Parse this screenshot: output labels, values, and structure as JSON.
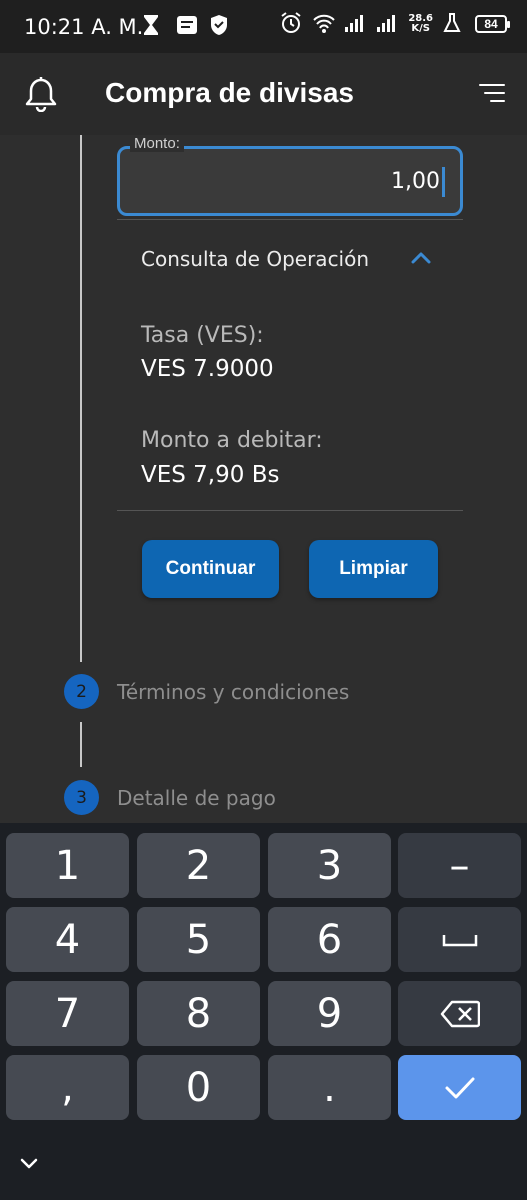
{
  "status_bar": {
    "time": "10:21 A. M.",
    "net_speed_value": "28.6",
    "net_speed_unit": "K/S",
    "battery": "84"
  },
  "app_bar": {
    "title": "Compra de divisas",
    "left_icon": "bell-icon",
    "right_icon": "menu-icon"
  },
  "amount_field": {
    "label": "Monto:",
    "value": "1,00"
  },
  "operation_panel": {
    "title": "Consulta de Operación",
    "rate_label": "Tasa (VES):",
    "rate_value": "VES 7.9000",
    "debit_label": "Monto a debitar:",
    "debit_value": "VES 7,90 Bs"
  },
  "buttons": {
    "continue_label": "Continuar",
    "clear_label": "Limpiar"
  },
  "steps": [
    {
      "number": "2",
      "label": "Términos y condiciones"
    },
    {
      "number": "3",
      "label": "Detalle de pago"
    }
  ],
  "keyboard": {
    "keys": [
      "1",
      "2",
      "3",
      "–",
      "4",
      "5",
      "6",
      "space",
      "7",
      "8",
      "9",
      "backspace",
      ",",
      "0",
      ".",
      "enter"
    ]
  },
  "colors": {
    "accent": "#0e66b2",
    "field_border": "#3b8ad2",
    "enter_key": "#5c95eb",
    "background": "#2e2e2e"
  }
}
